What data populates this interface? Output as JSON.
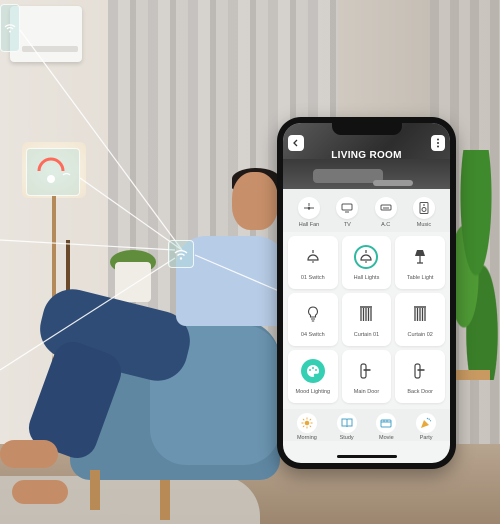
{
  "header": {
    "title": "LIVING ROOM"
  },
  "devices": [
    {
      "label": "Hall Fan",
      "icon": "ceiling-fan-icon"
    },
    {
      "label": "TV",
      "icon": "tv-icon"
    },
    {
      "label": "A.C",
      "icon": "air-conditioner-icon"
    },
    {
      "label": "Music",
      "icon": "speaker-icon"
    }
  ],
  "controls": [
    {
      "label": "01 Switch",
      "icon": "ceiling-lamp-icon",
      "state": "off"
    },
    {
      "label": "Hall Lights",
      "icon": "ceiling-lamp-icon",
      "state": "on"
    },
    {
      "label": "Table Light",
      "icon": "table-lamp-icon",
      "state": "off"
    },
    {
      "label": "04 Switch",
      "icon": "bulb-icon",
      "state": "off"
    },
    {
      "label": "Curtain 01",
      "icon": "curtain-icon",
      "state": "off"
    },
    {
      "label": "Curtain 02",
      "icon": "curtain-icon",
      "state": "off"
    },
    {
      "label": "Mood Lighting",
      "icon": "palette-icon",
      "state": "on"
    },
    {
      "label": "Main Door",
      "icon": "door-handle-icon",
      "state": "off"
    },
    {
      "label": "Back Door",
      "icon": "door-handle-icon",
      "state": "off"
    }
  ],
  "scenes": [
    {
      "label": "Morning",
      "icon": "sun-icon"
    },
    {
      "label": "Study",
      "icon": "book-icon"
    },
    {
      "label": "Movie",
      "icon": "movie-icon"
    },
    {
      "label": "Party",
      "icon": "party-icon"
    }
  ],
  "colors": {
    "accent": "#2fb9a1",
    "accent_fill": "#35d0b3",
    "screen_bg": "#f3f4f4"
  }
}
